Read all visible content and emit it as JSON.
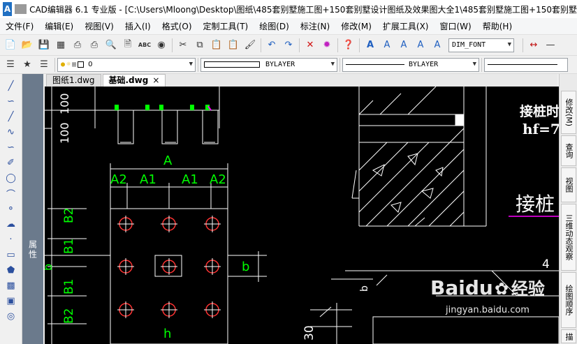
{
  "title": {
    "logo": "A",
    "text": "CAD编辑器 6.1 专业版  - [C:\\Users\\Mloong\\Desktop\\图纸\\485套别墅施工图+150套别墅设计图纸及效果图大全1\\485套别墅施工图+150套别墅"
  },
  "menu": [
    "文件(F)",
    "编辑(E)",
    "视图(V)",
    "插入(I)",
    "格式(O)",
    "定制工具(T)",
    "绘图(D)",
    "标注(N)",
    "修改(M)",
    "扩展工具(X)",
    "窗口(W)",
    "帮助(H)"
  ],
  "toolbar": {
    "font_style": "DIM_FONT",
    "layer": "0",
    "linetype_label": "BYLAYER",
    "lineweight_label": "BYLAYER"
  },
  "tabs": [
    {
      "label": "图纸1.dwg",
      "active": false
    },
    {
      "label": "基础.dwg",
      "active": true,
      "close": "×"
    }
  ],
  "left_panel": {
    "title": "属性"
  },
  "right_tabs": [
    "修改(M)",
    "查询",
    "视图",
    "三维动态观察",
    "绘图顺序",
    "描"
  ],
  "drawing": {
    "labels": {
      "A": "A",
      "A2": "A2",
      "A1": "A1",
      "B2": "B2",
      "B1": "B1",
      "b": "b",
      "h": "h",
      "n100": "100",
      "n30": "30",
      "n4": "4",
      "title1": "接桩时",
      "hf": "hf=7",
      "title2": "接桩"
    }
  },
  "colors": {
    "canvas_bg": "#000000",
    "line": "#ffffff",
    "dim": "#00ff00",
    "circle": "#ff3333",
    "magenta": "#ff00ff"
  },
  "watermark": {
    "brand": "Baidu",
    "text_cn": "经验",
    "url": "jingyan.baidu.com"
  }
}
